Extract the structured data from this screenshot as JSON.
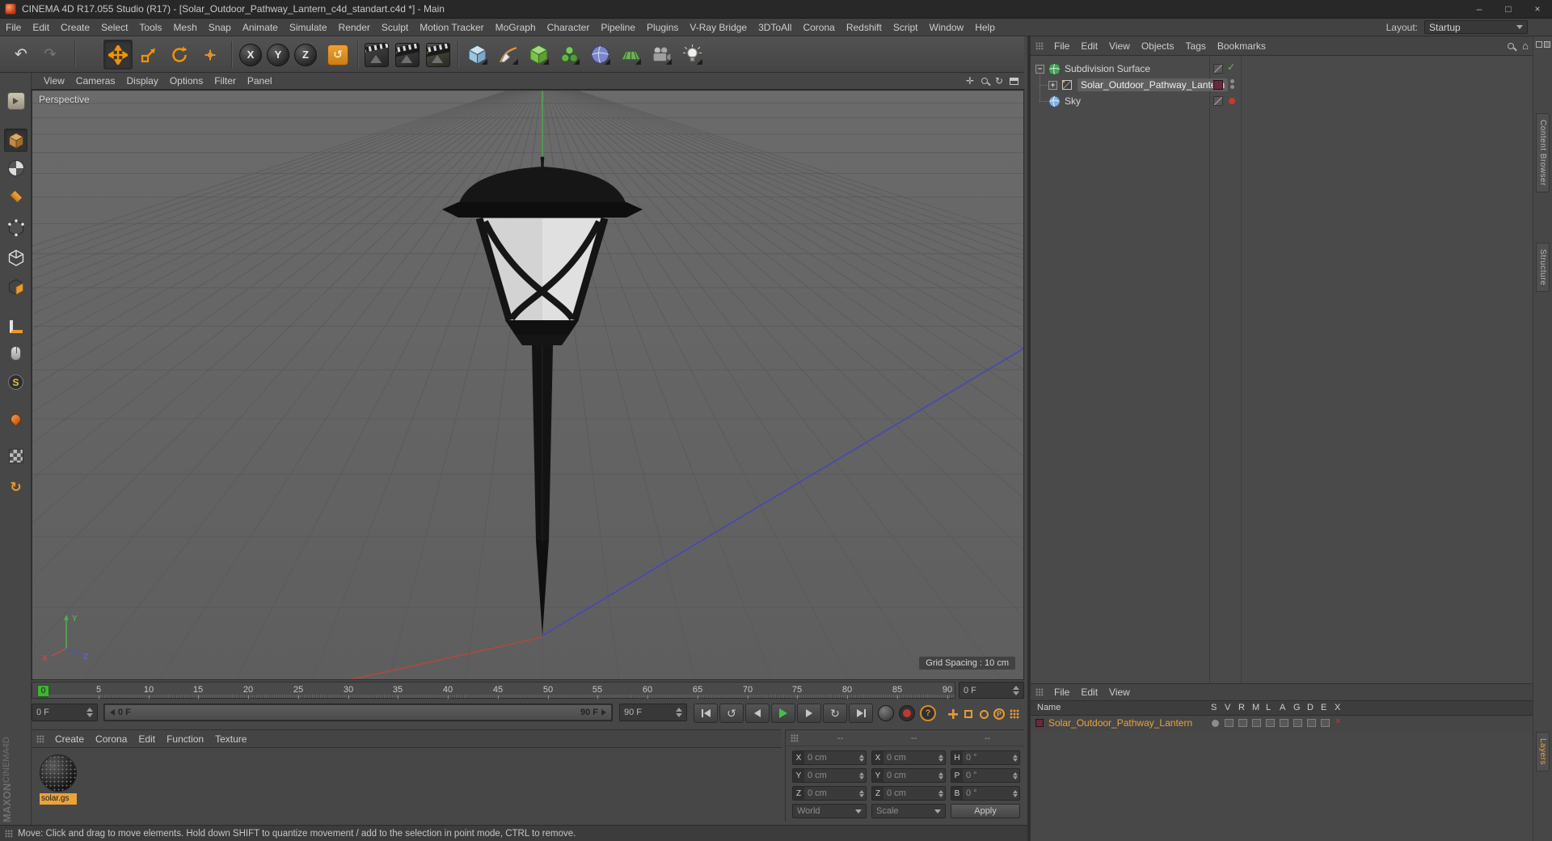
{
  "titlebar": {
    "title": "CINEMA 4D R17.055 Studio (R17) - [Solar_Outdoor_Pathway_Lantern_c4d_standart.c4d *] - Main",
    "minimize": "–",
    "maximize": "□",
    "close": "×"
  },
  "menubar": {
    "items": [
      "File",
      "Edit",
      "Create",
      "Select",
      "Tools",
      "Mesh",
      "Snap",
      "Animate",
      "Simulate",
      "Render",
      "Sculpt",
      "Motion Tracker",
      "MoGraph",
      "Character",
      "Pipeline",
      "Plugins",
      "V-Ray Bridge",
      "3DToAll",
      "Corona",
      "Redshift",
      "Script",
      "Window",
      "Help"
    ],
    "layout_label": "Layout:",
    "layout_value": "Startup"
  },
  "toolbar": {
    "axis_x": "X",
    "axis_y": "Y",
    "axis_z": "Z"
  },
  "viewport": {
    "menu": [
      "View",
      "Cameras",
      "Display",
      "Options",
      "Filter",
      "Panel"
    ],
    "label": "Perspective",
    "grid_spacing": "Grid Spacing : 10 cm",
    "gizmo": {
      "x": "X",
      "y": "Y",
      "z": "Z"
    }
  },
  "timeline": {
    "marker": "0",
    "ticks": [
      "5",
      "10",
      "15",
      "20",
      "25",
      "30",
      "35",
      "40",
      "45",
      "50",
      "55",
      "60",
      "65",
      "70",
      "75",
      "80",
      "85",
      "90"
    ],
    "current_frame": "0 F",
    "preview_start": "0 F",
    "range_start_label": "0 F",
    "range_end_label": "90 F",
    "preview_end": "90 F",
    "param_label": "P"
  },
  "materials": {
    "menu": [
      "Create",
      "Corona",
      "Edit",
      "Function",
      "Texture"
    ],
    "selected_material": "solar.gs"
  },
  "coordinates": {
    "headers": [
      "--",
      "--",
      "--"
    ],
    "rows": [
      {
        "c1_label": "X",
        "c1": "0 cm",
        "c2_label": "X",
        "c2": "0 cm",
        "c3_label": "H",
        "c3": "0 °"
      },
      {
        "c1_label": "Y",
        "c1": "0 cm",
        "c2_label": "Y",
        "c2": "0 cm",
        "c3_label": "P",
        "c3": "0 °"
      },
      {
        "c1_label": "Z",
        "c1": "0 cm",
        "c2_label": "Z",
        "c2": "0 cm",
        "c3_label": "B",
        "c3": "0 °"
      }
    ],
    "world": "World",
    "scale": "Scale",
    "apply": "Apply"
  },
  "object_manager": {
    "menu": [
      "File",
      "Edit",
      "View",
      "Objects",
      "Tags",
      "Bookmarks"
    ],
    "objects": [
      {
        "name": "Subdivision Surface"
      },
      {
        "name": "Solar_Outdoor_Pathway_Lantern"
      },
      {
        "name": "Sky"
      }
    ]
  },
  "layer_manager": {
    "menu": [
      "File",
      "Edit",
      "View"
    ],
    "name_header": "Name",
    "columns": [
      "S",
      "V",
      "R",
      "M",
      "L",
      "A",
      "G",
      "D",
      "E",
      "X"
    ],
    "layers": [
      {
        "name": "Solar_Outdoor_Pathway_Lantern"
      }
    ]
  },
  "side_tabs": {
    "upper": [
      "Content Browser",
      "Structure"
    ],
    "lower": "Layers"
  },
  "branding": {
    "maxon": "MAXON",
    "cinema": "CINEMA4D"
  },
  "statusbar": {
    "text": "Move: Click and drag to move elements. Hold down SHIFT to quantize movement / add to the selection in point mode, CTRL to remove."
  }
}
